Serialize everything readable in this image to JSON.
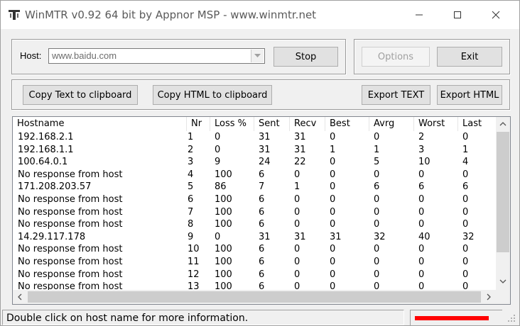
{
  "window": {
    "title": "WinMTR v0.92 64 bit by Appnor MSP - www.winmtr.net"
  },
  "host": {
    "label": "Host:",
    "value": "www.baidu.com"
  },
  "buttons": {
    "stop": "Stop",
    "options": "Options",
    "exit": "Exit",
    "copy_text": "Copy Text to clipboard",
    "copy_html": "Copy HTML to clipboard",
    "export_text": "Export TEXT",
    "export_html": "Export HTML"
  },
  "table": {
    "columns": [
      "Hostname",
      "Nr",
      "Loss %",
      "Sent",
      "Recv",
      "Best",
      "Avrg",
      "Worst",
      "Last"
    ],
    "rows": [
      [
        "192.168.2.1",
        "1",
        "0",
        "31",
        "31",
        "0",
        "0",
        "2",
        "0"
      ],
      [
        "192.168.1.1",
        "2",
        "0",
        "31",
        "31",
        "1",
        "1",
        "3",
        "1"
      ],
      [
        "100.64.0.1",
        "3",
        "9",
        "24",
        "22",
        "0",
        "5",
        "10",
        "4"
      ],
      [
        "No response from host",
        "4",
        "100",
        "6",
        "0",
        "0",
        "0",
        "0",
        "0"
      ],
      [
        "171.208.203.57",
        "5",
        "86",
        "7",
        "1",
        "0",
        "6",
        "6",
        "6"
      ],
      [
        "No response from host",
        "6",
        "100",
        "6",
        "0",
        "0",
        "0",
        "0",
        "0"
      ],
      [
        "No response from host",
        "7",
        "100",
        "6",
        "0",
        "0",
        "0",
        "0",
        "0"
      ],
      [
        "No response from host",
        "8",
        "100",
        "6",
        "0",
        "0",
        "0",
        "0",
        "0"
      ],
      [
        "14.29.117.178",
        "9",
        "0",
        "31",
        "31",
        "31",
        "32",
        "40",
        "32"
      ],
      [
        "No response from host",
        "10",
        "100",
        "6",
        "0",
        "0",
        "0",
        "0",
        "0"
      ],
      [
        "No response from host",
        "11",
        "100",
        "6",
        "0",
        "0",
        "0",
        "0",
        "0"
      ],
      [
        "No response from host",
        "12",
        "100",
        "6",
        "0",
        "0",
        "0",
        "0",
        "0"
      ],
      [
        "No response from host",
        "13",
        "100",
        "6",
        "0",
        "0",
        "0",
        "0",
        "0"
      ]
    ]
  },
  "status": {
    "text": "Double click on host name for more information."
  },
  "colors": {
    "redaction": "#ff0000"
  }
}
